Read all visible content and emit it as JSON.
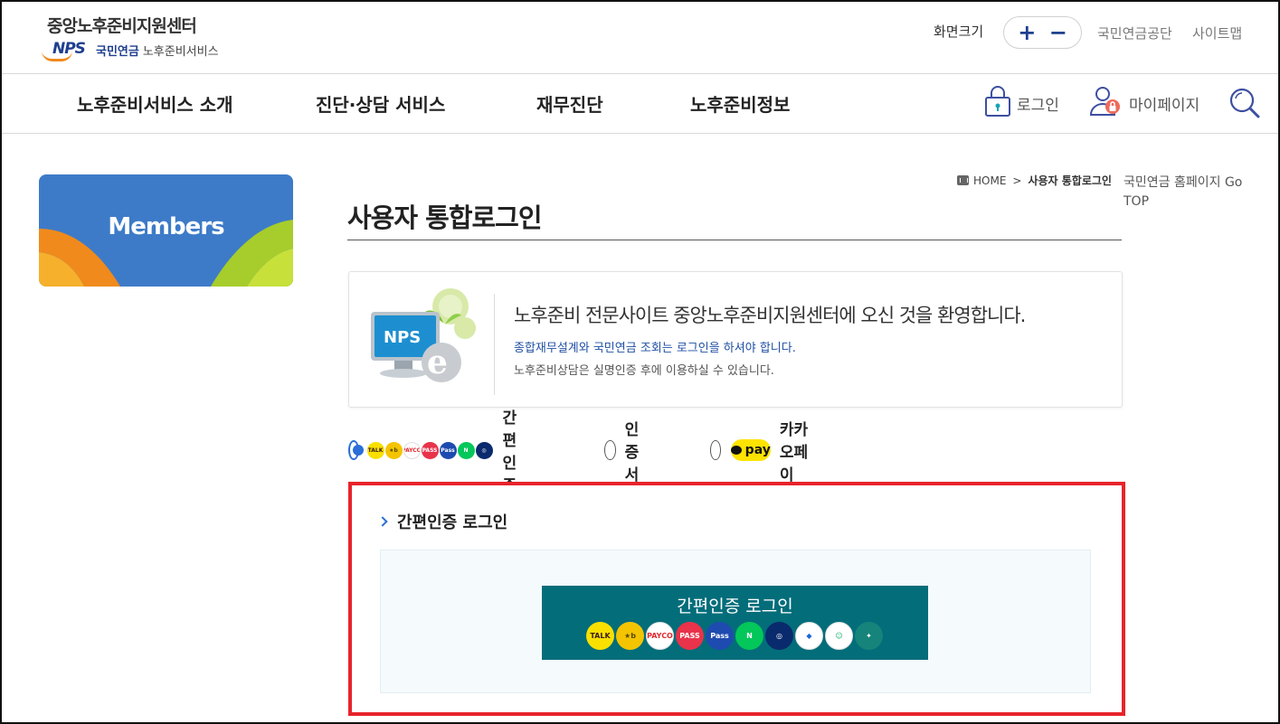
{
  "header": {
    "logo_title": "중앙노후준비지원센터",
    "logo_nps": "NPS",
    "logo_sub_a": "국민연금",
    "logo_sub_b": "노후준비서비스",
    "font_size_label": "화면크기",
    "font_plus": "+",
    "font_minus": "−",
    "links": [
      "국민연금공단",
      "사이트맵"
    ]
  },
  "gnb": {
    "items": [
      "노후준비서비스 소개",
      "진단·상담 서비스",
      "재무진단",
      "노후준비정보"
    ],
    "login_label": "로그인",
    "mypage_label": "마이페이지"
  },
  "sidebar": {
    "card_title": "Members"
  },
  "breadcrumb": {
    "home": "HOME",
    "sep": ">",
    "current": "사용자 통합로그인",
    "gotop_text": "국민연금 홈페이지 Go TOP"
  },
  "page": {
    "title": "사용자 통합로그인"
  },
  "welcome": {
    "image_text": "NPS",
    "heading": "노후준비 전문사이트 중앙노후준비지원센터에 오신 것을 환영합니다.",
    "notice_blue": "종합재무설계와 국민연금 조회는 로그인을 하셔야 합니다.",
    "notice_gray": "노후준비상담은 실명인증 후에 이용하실 수 있습니다."
  },
  "login_methods": {
    "options": [
      {
        "label": "간편인증",
        "selected": true
      },
      {
        "label": "인증서",
        "selected": false
      },
      {
        "label": "카카오페이",
        "selected": false
      }
    ],
    "mini_icons": [
      {
        "name": "kakaotalk",
        "text": "TALK",
        "bg": "#f9e000",
        "fg": "#3a1d1d"
      },
      {
        "name": "kb",
        "text": "★b",
        "bg": "#f4c400",
        "fg": "#5a4a00"
      },
      {
        "name": "payco",
        "text": "PAYCO",
        "bg": "#ffffff",
        "fg": "#e2282c"
      },
      {
        "name": "pass",
        "text": "PASS",
        "bg": "#e8334a",
        "fg": "#ffffff"
      },
      {
        "name": "samsung-pass",
        "text": "Pass",
        "bg": "#1e4bb0",
        "fg": "#ffffff"
      },
      {
        "name": "naver",
        "text": "N",
        "bg": "#03c75a",
        "fg": "#ffffff"
      },
      {
        "name": "shinhan",
        "text": "◎",
        "bg": "#0a2a6e",
        "fg": "#ffffff"
      }
    ],
    "kakaopay_text": "pay"
  },
  "simple_auth": {
    "heading": "간편인증 로그인",
    "button_label": "간편인증 로그인",
    "button_icons": [
      {
        "name": "kakaotalk",
        "text": "TALK",
        "bg": "#f9e000",
        "fg": "#3a1d1d"
      },
      {
        "name": "kb",
        "text": "★b",
        "bg": "#f4c400",
        "fg": "#5a4a00"
      },
      {
        "name": "payco",
        "text": "PAYCO",
        "bg": "#ffffff",
        "fg": "#e2282c"
      },
      {
        "name": "pass",
        "text": "PASS",
        "bg": "#e8334a",
        "fg": "#ffffff"
      },
      {
        "name": "samsung-pass",
        "text": "Pass",
        "bg": "#1e4bb0",
        "fg": "#ffffff"
      },
      {
        "name": "naver",
        "text": "N",
        "bg": "#03c75a",
        "fg": "#ffffff"
      },
      {
        "name": "shinhan",
        "text": "◎",
        "bg": "#0a2a6e",
        "fg": "#ffffff"
      },
      {
        "name": "toss",
        "text": "◆",
        "bg": "#ffffff",
        "fg": "#1b64da"
      },
      {
        "name": "bank-salad",
        "text": "☺",
        "bg": "#ffffff",
        "fg": "#16b26b"
      },
      {
        "name": "gov-wallet",
        "text": "✦",
        "bg": "#16847a",
        "fg": "#ffffff"
      }
    ]
  },
  "colors": {
    "primary_blue": "#1f3f8f",
    "radio_blue": "#2a6ed8",
    "panel_red": "#e8232b",
    "auth_button_teal": "#036d7a",
    "kakao_yellow": "#ffe300"
  }
}
